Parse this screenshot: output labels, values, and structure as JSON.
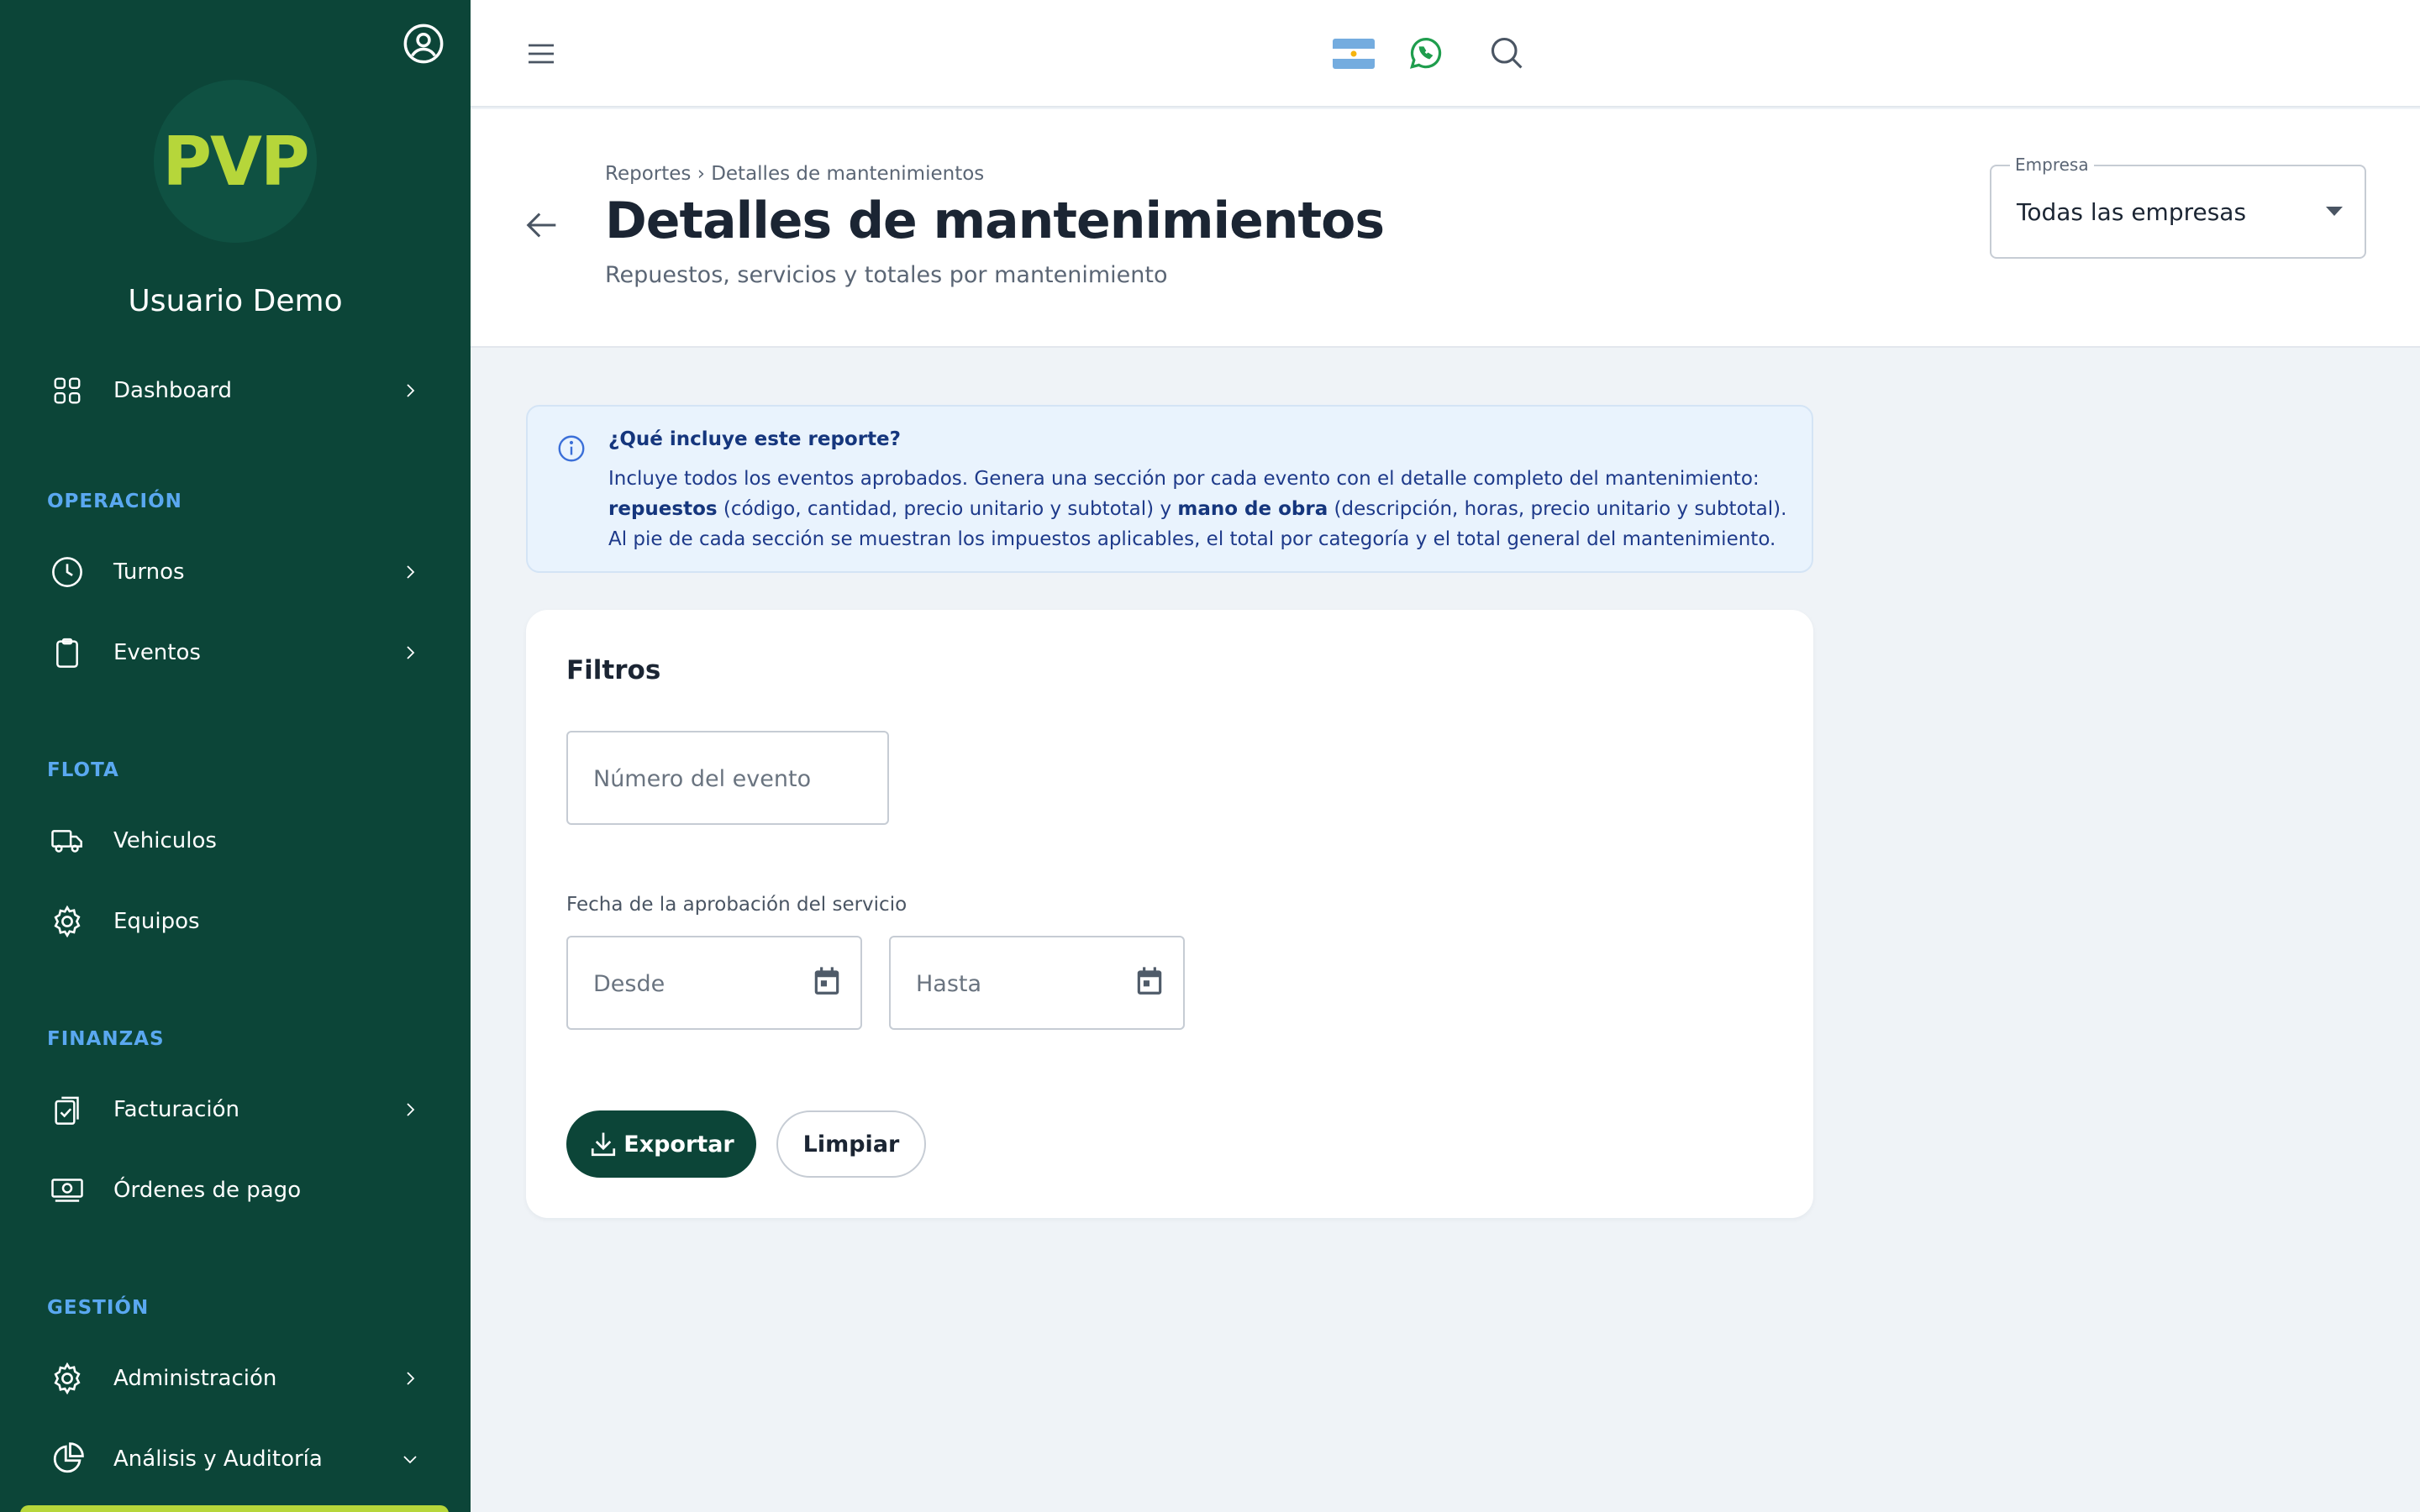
{
  "colors": {
    "sidebar_bg": "#0c4538",
    "brand_lime": "#b6d63a",
    "section_label": "#5aa8f0",
    "page_bg": "#eff3f7",
    "info_bg": "#e9f3fd",
    "info_text": "#1e3a8a",
    "primary_button": "#0c4538",
    "whatsapp": "#1f9d4d"
  },
  "sidebar": {
    "logo_text": "PVP",
    "user_name": "Usuario Demo",
    "profile_icon": "user-circle-icon",
    "items": [
      {
        "label": "Dashboard",
        "icon": "grid-icon",
        "chevron": "right"
      },
      {
        "section": "OPERACIÓN"
      },
      {
        "label": "Turnos",
        "icon": "clock-icon",
        "chevron": "right"
      },
      {
        "label": "Eventos",
        "icon": "clipboard-icon",
        "chevron": "right"
      },
      {
        "section": "FLOTA"
      },
      {
        "label": "Vehiculos",
        "icon": "truck-icon",
        "chevron": "none"
      },
      {
        "label": "Equipos",
        "icon": "gear-icon",
        "chevron": "none"
      },
      {
        "section": "FINANZAS"
      },
      {
        "label": "Facturación",
        "icon": "clipboard-check-icon",
        "chevron": "right"
      },
      {
        "label": "Órdenes de pago",
        "icon": "money-icon",
        "chevron": "none"
      },
      {
        "section": "GESTIÓN"
      },
      {
        "label": "Administración",
        "icon": "gear-icon",
        "chevron": "right"
      },
      {
        "label": "Análisis y Auditoría",
        "icon": "pie-chart-icon",
        "chevron": "down"
      }
    ]
  },
  "topbar": {
    "menu_icon": "hamburger-icon",
    "flag_icon": "argentina-flag-icon",
    "whatsapp_icon": "whatsapp-icon",
    "search_icon": "search-icon"
  },
  "header": {
    "breadcrumb": "Reportes › Detalles de mantenimientos",
    "title": "Detalles de mantenimientos",
    "subtitle": "Repuestos, servicios y totales por mantenimiento",
    "company_label": "Empresa",
    "company_value": "Todas las empresas"
  },
  "info": {
    "title": "¿Qué incluye este reporte?",
    "body_1": "Incluye todos los eventos aprobados. Genera una sección por cada evento con el detalle completo del mantenimiento: ",
    "bold_1": "repuestos",
    "body_2": " (código, cantidad, precio unitario y subtotal) y ",
    "bold_2": "mano de obra",
    "body_3": " (descripción, horas, precio unitario y subtotal). Al pie de cada sección se muestran los impuestos aplicables, el total por categoría y el total general del mantenimiento."
  },
  "filters": {
    "title": "Filtros",
    "event_number_placeholder": "Número del evento",
    "date_label": "Fecha de la aprobación del servicio",
    "from_placeholder": "Desde",
    "to_placeholder": "Hasta",
    "export_label": "Exportar",
    "clear_label": "Limpiar"
  }
}
